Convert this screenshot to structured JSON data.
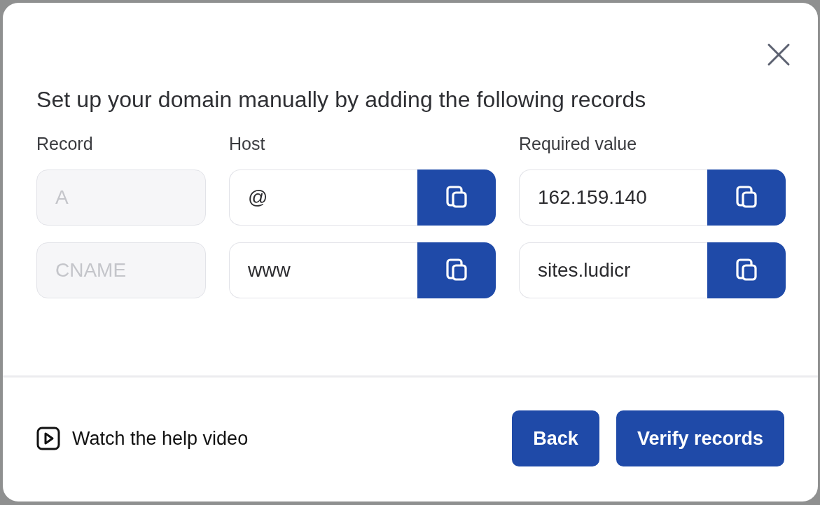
{
  "dialog": {
    "title": "Set up your domain manually by adding the following records",
    "columns": [
      "Record",
      "Host",
      "Required value"
    ],
    "rows": [
      {
        "record": {
          "value": "A",
          "disabled": true
        },
        "host": "@",
        "required_value": "162.159.140"
      },
      {
        "record": {
          "value": "CNAME",
          "disabled": true
        },
        "host": "www",
        "required_value": "sites.ludicr"
      }
    ],
    "help_link": "Watch the help video",
    "buttons": [
      "Back",
      "Verify records"
    ]
  }
}
